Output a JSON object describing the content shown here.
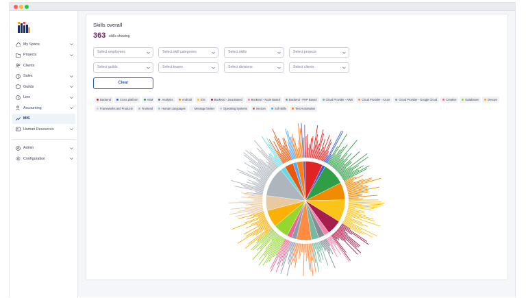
{
  "sidebar": {
    "items": [
      {
        "label": "My Space",
        "icon": "home-icon",
        "chevron": true
      },
      {
        "label": "Projects",
        "icon": "folder-icon",
        "chevron": true
      },
      {
        "label": "Clients",
        "icon": "users-icon",
        "chevron": false
      },
      {
        "label": "Sales",
        "icon": "dollar-icon",
        "chevron": true
      },
      {
        "label": "Guilds",
        "icon": "shield-icon",
        "chevron": true
      },
      {
        "label": "Line",
        "icon": "clock-icon",
        "chevron": true
      },
      {
        "label": "Accounting",
        "icon": "user-cog-icon",
        "chevron": true
      },
      {
        "label": "MIS",
        "icon": "trend-icon",
        "chevron": false,
        "active": true
      },
      {
        "label": "Human Resources",
        "icon": "id-card-icon",
        "chevron": true
      }
    ],
    "bottom_items": [
      {
        "label": "Admin",
        "icon": "settings-icon",
        "chevron": true
      },
      {
        "label": "Configuration",
        "icon": "gear-icon",
        "chevron": true
      }
    ]
  },
  "main": {
    "title": "Skills overall",
    "count": "363",
    "count_label": "skills showing",
    "filters": [
      {
        "placeholder": "Select employees"
      },
      {
        "placeholder": "Select skill categories"
      },
      {
        "placeholder": "Select skills"
      },
      {
        "placeholder": "Select projects"
      },
      {
        "placeholder": "Select guilds"
      },
      {
        "placeholder": "Select teams"
      },
      {
        "placeholder": "Select divisions"
      },
      {
        "placeholder": "Select clients"
      }
    ],
    "clear_label": "Clear"
  },
  "legend": [
    {
      "label": "Backend",
      "color": "#e02424"
    },
    {
      "label": "Cross platform",
      "color": "#3b5bdb"
    },
    {
      "label": "ASM",
      "color": "#2f9e44"
    },
    {
      "label": "Analytics",
      "color": "#7b5ea7"
    },
    {
      "label": "Android",
      "color": "#f08c00"
    },
    {
      "label": "iOS",
      "color": "#fcc419"
    },
    {
      "label": "Backend - Java Based",
      "color": "#a61e4d"
    },
    {
      "label": "Backend - Node Based",
      "color": "#f783ac"
    },
    {
      "label": "Backend - PHP Based",
      "color": "#868e96"
    },
    {
      "label": "Cloud Provider - AWS",
      "color": "#74b9a0"
    },
    {
      "label": "Cloud Provider - Azure",
      "color": "#ff8c42"
    },
    {
      "label": "Cloud Provider - Google Cloud",
      "color": "#8c9bab"
    },
    {
      "label": "Creative",
      "color": "#f06595"
    },
    {
      "label": "Databases",
      "color": "#94d82d"
    },
    {
      "label": "Devops",
      "color": "#fab005"
    },
    {
      "label": "Frameworks and Products",
      "color": "#e9c9a0"
    },
    {
      "label": "Frontend",
      "color": "#adb5bd"
    },
    {
      "label": "Human Languages",
      "color": "#66d9e8"
    },
    {
      "label": "Message broker",
      "color": "#e9ecef"
    },
    {
      "label": "Operating Systems",
      "color": "#a5d8ff"
    },
    {
      "label": "Sectors",
      "color": "#e8590c"
    },
    {
      "label": "Soft skills",
      "color": "#4dabf7"
    },
    {
      "label": "Test Automation",
      "color": "#fd7e14"
    }
  ],
  "chart_data": {
    "type": "pie",
    "total_skills": 363,
    "categories": [
      "Backend",
      "Cross platform",
      "ASM",
      "Android",
      "iOS",
      "Backend - Java Based",
      "Backend - Node Based",
      "Backend - PHP Based",
      "Cloud Provider - AWS",
      "Cloud Provider - Azure",
      "Cloud Provider - Google Cloud",
      "Creative",
      "Databases",
      "Devops",
      "Frameworks and Products",
      "Frontend",
      "Human Languages",
      "Sectors",
      "Soft skills",
      "Test Automation",
      "Analytics"
    ],
    "values": [
      7,
      1.2,
      9,
      7,
      9,
      6,
      2,
      2.5,
      3,
      6,
      2,
      2,
      6,
      7,
      6,
      12,
      2,
      3.5,
      1.5,
      2.5,
      1
    ],
    "colors": [
      "#e02424",
      "#3b5bdb",
      "#2f9e44",
      "#f08c00",
      "#fcc419",
      "#a61e4d",
      "#f783ac",
      "#868e96",
      "#74b9a0",
      "#ff8c42",
      "#8c9bab",
      "#f06595",
      "#94d82d",
      "#fab005",
      "#e9c9a0",
      "#adb5bd",
      "#66d9e8",
      "#e8590c",
      "#4dabf7",
      "#fd7e14",
      "#7b5ea7"
    ],
    "radial_bars": true
  }
}
